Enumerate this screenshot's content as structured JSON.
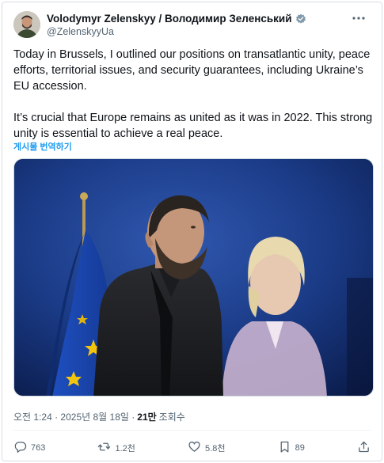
{
  "author": {
    "display_name": "Volodymyr Zelenskyy / Володимир Зеленський",
    "handle": "@ZelenskyyUa"
  },
  "post": {
    "paragraph_1": "Today in Brussels, I outlined our positions on transatlantic unity, peace efforts, territorial issues, and security guarantees, including Ukraine’s EU accession.",
    "paragraph_2": "It’s crucial that Europe remains as united as it was in 2022. This strong unity is essential to achieve a real peace.",
    "translate_label": "게시물 번역하기"
  },
  "meta": {
    "timestamp": "오전 1:24 · 2025년 8월 18일 ·",
    "views_count": "21만",
    "views_label": "조회수"
  },
  "actions": {
    "replies": "763",
    "reposts": "1.2천",
    "likes": "5.8천",
    "bookmarks": "89"
  },
  "icons": [
    "verified-badge-icon",
    "more-icon",
    "reply-icon",
    "repost-icon",
    "like-icon",
    "bookmark-icon",
    "share-icon"
  ],
  "colors": {
    "link": "#1d9bf0",
    "secondary_text": "#536471",
    "primary_text": "#0f1419"
  }
}
